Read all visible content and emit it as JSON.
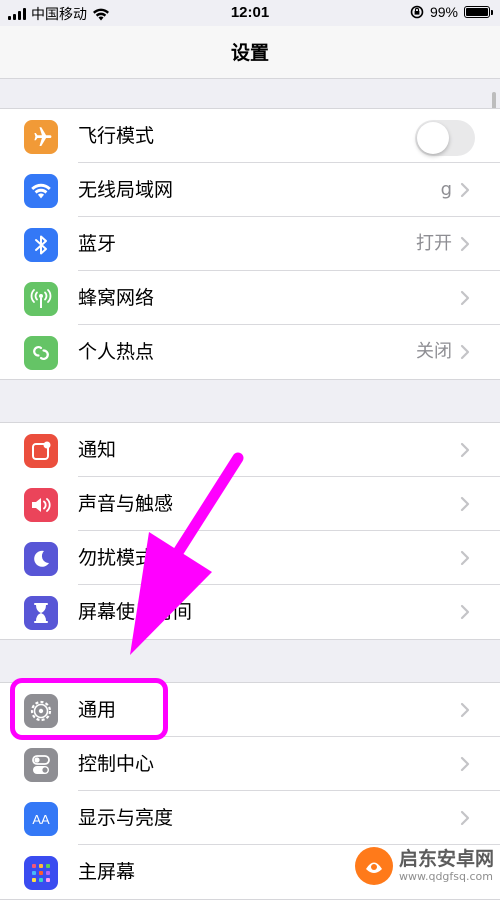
{
  "status_bar": {
    "carrier": "中国移动",
    "time": "12:01",
    "battery": "99%"
  },
  "nav": {
    "title": "设置"
  },
  "groups": [
    {
      "items": [
        {
          "label": "飞行模式",
          "icon": "airplane-icon",
          "color": "#f19a37",
          "control": "toggle",
          "toggle_on": false
        },
        {
          "label": "无线局域网",
          "icon": "wifi-icon",
          "color": "#3478f6",
          "value": "g"
        },
        {
          "label": "蓝牙",
          "icon": "bluetooth-icon",
          "color": "#3478f6",
          "value": "打开"
        },
        {
          "label": "蜂窝网络",
          "icon": "cellular-icon",
          "color": "#65c466"
        },
        {
          "label": "个人热点",
          "icon": "hotspot-icon",
          "color": "#65c466",
          "value": "关闭"
        }
      ]
    },
    {
      "items": [
        {
          "label": "通知",
          "icon": "notification-icon",
          "color": "#eb4e3d"
        },
        {
          "label": "声音与触感",
          "icon": "sound-icon",
          "color": "#eb445a"
        },
        {
          "label": "勿扰模式",
          "icon": "moon-icon",
          "color": "#5856d6"
        },
        {
          "label": "屏幕使用时间",
          "icon": "hourglass-icon",
          "color": "#5856d6"
        }
      ]
    },
    {
      "items": [
        {
          "label": "通用",
          "icon": "gear-icon",
          "color": "#8e8e93"
        },
        {
          "label": "控制中心",
          "icon": "control-center-icon",
          "color": "#8e8e93"
        },
        {
          "label": "显示与亮度",
          "icon": "display-icon",
          "color": "#3478f6"
        },
        {
          "label": "主屏幕",
          "icon": "home-screen-icon",
          "color": "#3a4cf0"
        }
      ]
    }
  ],
  "annotation": {
    "color": "#ff00ff"
  },
  "watermark": {
    "title": "启东安卓网",
    "url": "www.qdgfsq.com"
  }
}
